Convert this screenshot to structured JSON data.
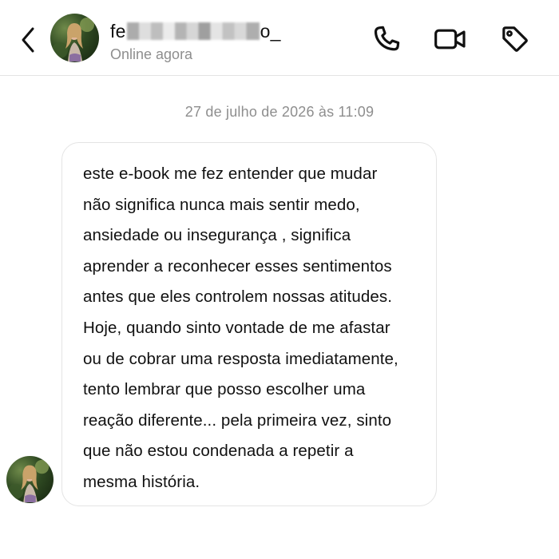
{
  "header": {
    "contact_name_start": "fe",
    "contact_name_end": "o_",
    "status": "Online agora",
    "icons": {
      "back": "chevron-left-icon",
      "call": "phone-icon",
      "video": "video-camera-icon",
      "tag": "tag-icon"
    }
  },
  "conversation": {
    "timestamp": "27 de julho de 2026 às 11:09",
    "message": {
      "lines": [
        "este e-book me fez entender que mudar",
        "não significa nunca mais sentir medo,",
        "ansiedade ou insegurança , significa",
        "aprender a reconhecer esses sentimentos",
        "antes que eles controlem nossas atitudes.",
        "Hoje, quando sinto vontade de me afastar",
        "ou de cobrar uma resposta imediatamente,",
        "tento lembrar que posso escolher uma",
        "reação diferente... pela primeira vez, sinto",
        "que não estou condenada a repetir a",
        "mesma história."
      ]
    }
  },
  "colors": {
    "text_primary": "#111111",
    "text_secondary": "#8e8e8e",
    "bubble_border": "#e4e4e4",
    "divider": "#e3e3e3"
  }
}
